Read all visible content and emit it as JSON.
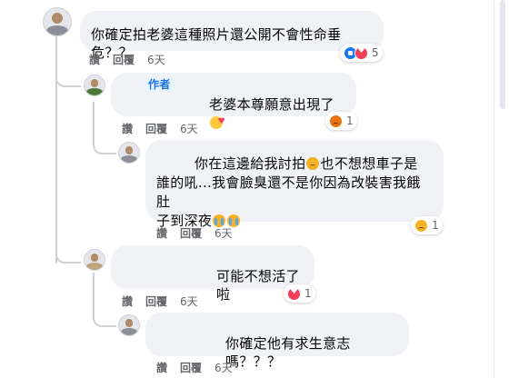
{
  "comments": [
    {
      "id": "c1",
      "text": "你確定拍老婆這種照片還公開不會性命垂危？？",
      "actions": {
        "like": "讚",
        "reply": "回覆",
        "time": "6天"
      },
      "reactions": {
        "count": "5",
        "types": [
          "like-icon",
          "love-icon"
        ]
      }
    },
    {
      "id": "c2",
      "badge": "作者",
      "text": "老婆本尊願意出現了",
      "inline_emoji": "smiling-face-with-hearts-emoji",
      "actions": {
        "like": "讚",
        "reply": "回覆",
        "time": "6天"
      },
      "reactions": {
        "count": "1",
        "types": [
          "angry-icon"
        ]
      }
    },
    {
      "id": "c3",
      "lines": [
        "你在這邊給我討拍",
        "也不想想車子是",
        "誰的吼...我會臉臭還不是你因為改裝害我餓肚",
        "子到深夜"
      ],
      "actions": {
        "like": "讚",
        "reply": "回覆",
        "time": "6天"
      },
      "reactions": {
        "count": "1",
        "types": [
          "sad-icon"
        ]
      }
    },
    {
      "id": "c4",
      "text": "可能不想活了啦",
      "actions": {
        "like": "讚",
        "reply": "回覆",
        "time": "6天"
      },
      "reactions": {
        "count": "1",
        "types": [
          "love-icon"
        ]
      }
    },
    {
      "id": "c5",
      "text": "你確定他有求生意志嗎？？？",
      "actions": {
        "like": "讚",
        "reply": "回覆",
        "time": "6天"
      }
    }
  ],
  "colors": {
    "bubble": "#f0f2f5",
    "action_text": "#65676b",
    "author_badge_bg": "#e7f3ff",
    "author_badge_text": "#1b74e4",
    "thread_line": "#ced0d4"
  }
}
